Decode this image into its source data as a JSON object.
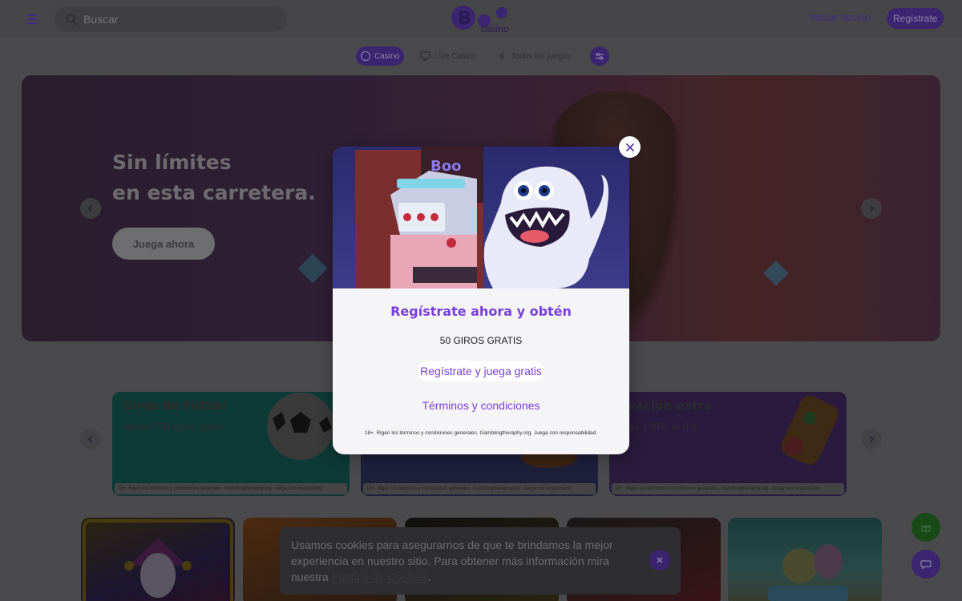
{
  "header": {
    "search_placeholder": "Buscar",
    "logo_text": "Boo casino",
    "login_label": "Iniciar sesión",
    "signup_label": "Regístrate"
  },
  "tabs": [
    {
      "label": "Casino",
      "icon": "casino-chip-icon",
      "active": true
    },
    {
      "label": "Live Casino",
      "icon": "tv-icon",
      "active": false
    },
    {
      "label": "Todos los juegos",
      "icon": "star-icon",
      "active": false
    }
  ],
  "hero": {
    "title_line1": "Sin límites",
    "title_line2": "en esta carretera.",
    "cta_label": "Juega ahora"
  },
  "promos": [
    {
      "title": "Giros de Fútbol",
      "subtitle": "Hasta 150 giros gratis",
      "footer": "18+. Rigen los términos y condiciones generales. Gamblingtheraphy.org. Juega con responsabil"
    },
    {
      "title": "",
      "subtitle": "",
      "footer": "18+. Rigen los términos y condiciones generales. Gamblingtheraphy.org. Juega con responsabil"
    },
    {
      "title": "evación extra",
      "subtitle": "asta 100% al día",
      "footer": "18+. Rigen los términos y condiciones generales. Gamblingtheraphy.org. Juega con responsabil"
    }
  ],
  "cookie": {
    "text": "Usamos cookies para asegurarnos de que te brindamos la mejor experiencia en nuestro sitio. Para obtener más información mira nuestra",
    "link_label": "Política de Cookies",
    "trailing": "."
  },
  "modal": {
    "heading": "Regístrate ahora y obtén",
    "offer": "50 GIROS GRATIS",
    "cta_label": "Regístrate y juega gratis",
    "terms_label": "Términos y condiciones",
    "disclaimer": "18+. Rigen los términos y condiciones generales. Gamblingtheraphy.org. Juega con responsabilidad.",
    "art_logo_text": "Boo casino"
  },
  "colors": {
    "brand_purple": "#7a3fd8",
    "header_bg": "#464547",
    "accent_dark": "#3b2470"
  }
}
